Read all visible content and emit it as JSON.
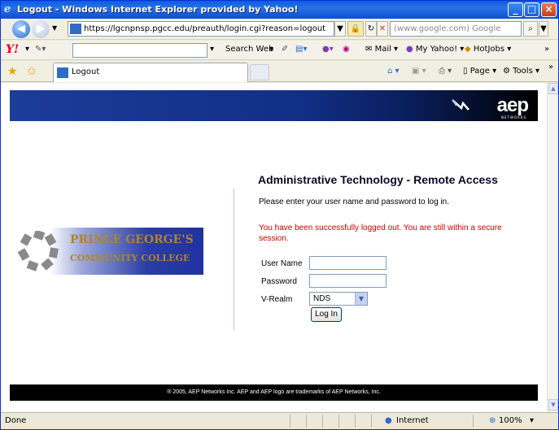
{
  "window": {
    "title": "Logout - Windows Internet Explorer provided by Yahoo!"
  },
  "address_bar": {
    "url": "https://lgcnpnsp.pgcc.edu/preauth/login.cgi?reason=logout",
    "search_placeholder": "(www.google.com) Google"
  },
  "yahoo_toolbar": {
    "search_web_label": "Search Web",
    "mail_label": "Mail",
    "my_yahoo_label": "My Yahoo!",
    "hotjobs_label": "HotJobs"
  },
  "tabs": {
    "active_label": "Logout"
  },
  "command_bar": {
    "page_label": "Page",
    "tools_label": "Tools"
  },
  "page": {
    "vendor_logo": "aep",
    "vendor_subtext": "NETWORKS",
    "college_line1": "PRINCE GEORGE'S",
    "college_line2": "COMMUNITY COLLEGE",
    "heading": "Administrative Technology - Remote Access",
    "prompt": "Please enter your user name and password to log in.",
    "logout_message": "You have been successfully logged out. You are still within a secure session.",
    "form": {
      "user_name_label": "User Name",
      "user_name_value": "",
      "password_label": "Password",
      "password_value": "",
      "vrealm_label": "V-Realm",
      "vrealm_selected": "NDS",
      "login_button": "Log In"
    },
    "footer": "® 2005, AEP Networks Inc. AEP and AEP logo are trademarks of AEP Networks, Inc."
  },
  "status_bar": {
    "status_text": "Done",
    "zone": "Internet",
    "zoom": "100%"
  }
}
